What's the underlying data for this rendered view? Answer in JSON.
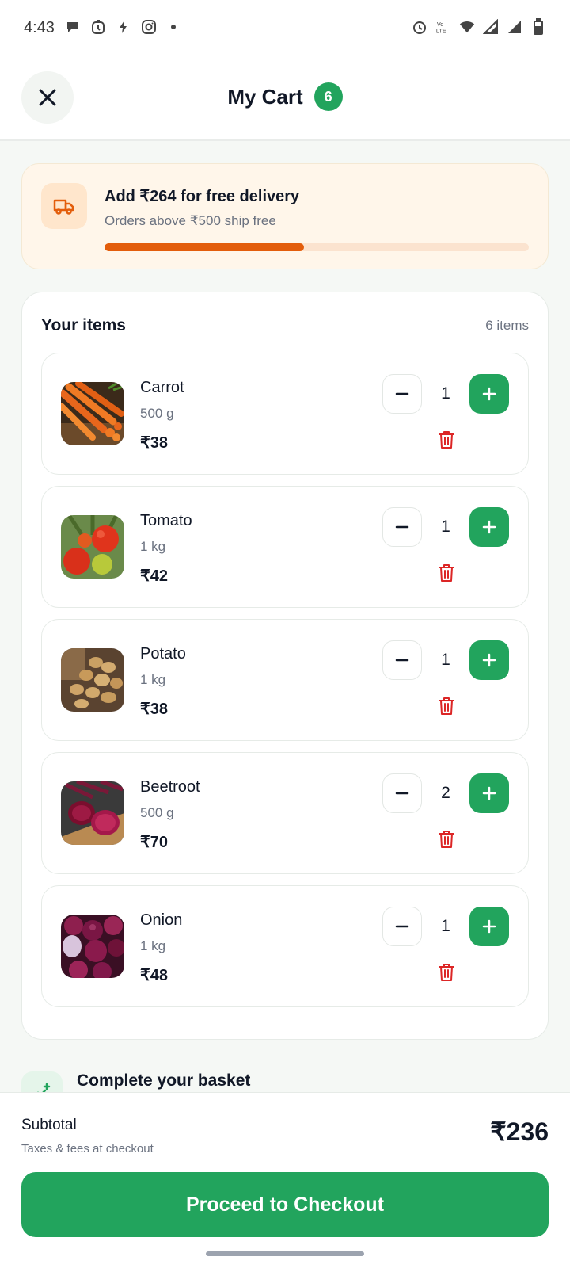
{
  "status_bar": {
    "time": "4:43",
    "left_icons": [
      "chat-bubble-icon",
      "timer-icon",
      "bolt-icon",
      "instagram-icon"
    ],
    "right_icons": [
      "alarm-icon",
      "volte-icon",
      "wifi-icon",
      "signal-icon",
      "signal-icon-2",
      "battery-icon"
    ]
  },
  "header": {
    "title": "My Cart",
    "badge_count": "6"
  },
  "delivery": {
    "title": "Add ₹264 for free delivery",
    "subtitle": "Orders above ₹500 ship free",
    "progress_fraction": 0.47,
    "accent_color": "#e35d0b"
  },
  "items_section": {
    "title": "Your items",
    "count_label": "6 items",
    "items": [
      {
        "name": "Carrot",
        "weight": "500 g",
        "price": "₹38",
        "quantity": "1"
      },
      {
        "name": "Tomato",
        "weight": "1 kg",
        "price": "₹42",
        "quantity": "1"
      },
      {
        "name": "Potato",
        "weight": "1 kg",
        "price": "₹38",
        "quantity": "1"
      },
      {
        "name": "Beetroot",
        "weight": "500 g",
        "price": "₹70",
        "quantity": "2"
      },
      {
        "name": "Onion",
        "weight": "1 kg",
        "price": "₹48",
        "quantity": "1"
      }
    ]
  },
  "basket": {
    "title": "Complete your basket"
  },
  "checkout": {
    "subtotal_label": "Subtotal",
    "subtotal_sub": "Taxes & fees at checkout",
    "subtotal_value": "₹236",
    "button_label": "Proceed to Checkout",
    "brand_color": "#22a45d"
  }
}
